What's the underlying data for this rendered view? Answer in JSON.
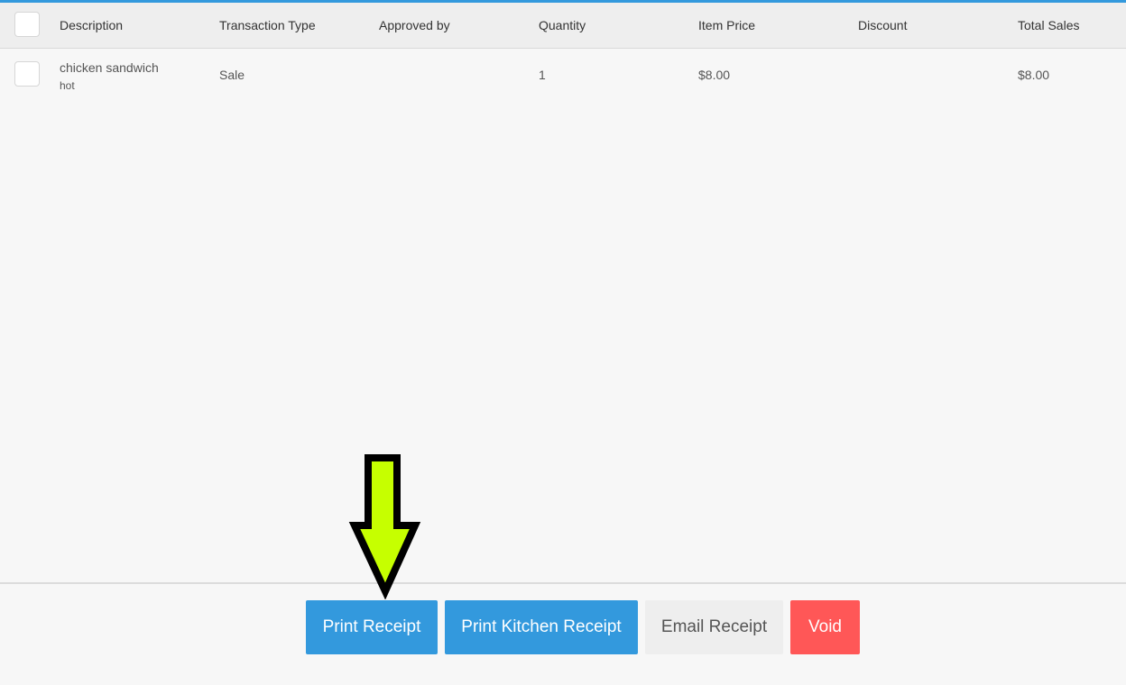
{
  "colors": {
    "accent": "#3399dd",
    "primary_button": "#3399dd",
    "email_button": "#eeeeee",
    "void_button": "#ff5757",
    "arrow_fill": "#c6ff00",
    "arrow_outline": "#000000"
  },
  "table": {
    "columns": [
      "Description",
      "Transaction Type",
      "Approved by",
      "Quantity",
      "Item Price",
      "Discount",
      "Total Sales"
    ],
    "rows": [
      {
        "description": "chicken sandwich",
        "modifier": "hot",
        "transaction_type": "Sale",
        "approved_by": "",
        "quantity": "1",
        "item_price": "$8.00",
        "discount": "",
        "total_sales": "$8.00"
      }
    ]
  },
  "actions": {
    "print_receipt": "Print Receipt",
    "print_kitchen_receipt": "Print Kitchen Receipt",
    "email_receipt": "Email Receipt",
    "void": "Void"
  },
  "icons": {
    "select_all": "checkbox-icon",
    "row_select": "checkbox-icon",
    "pointer": "down-arrow-icon"
  }
}
